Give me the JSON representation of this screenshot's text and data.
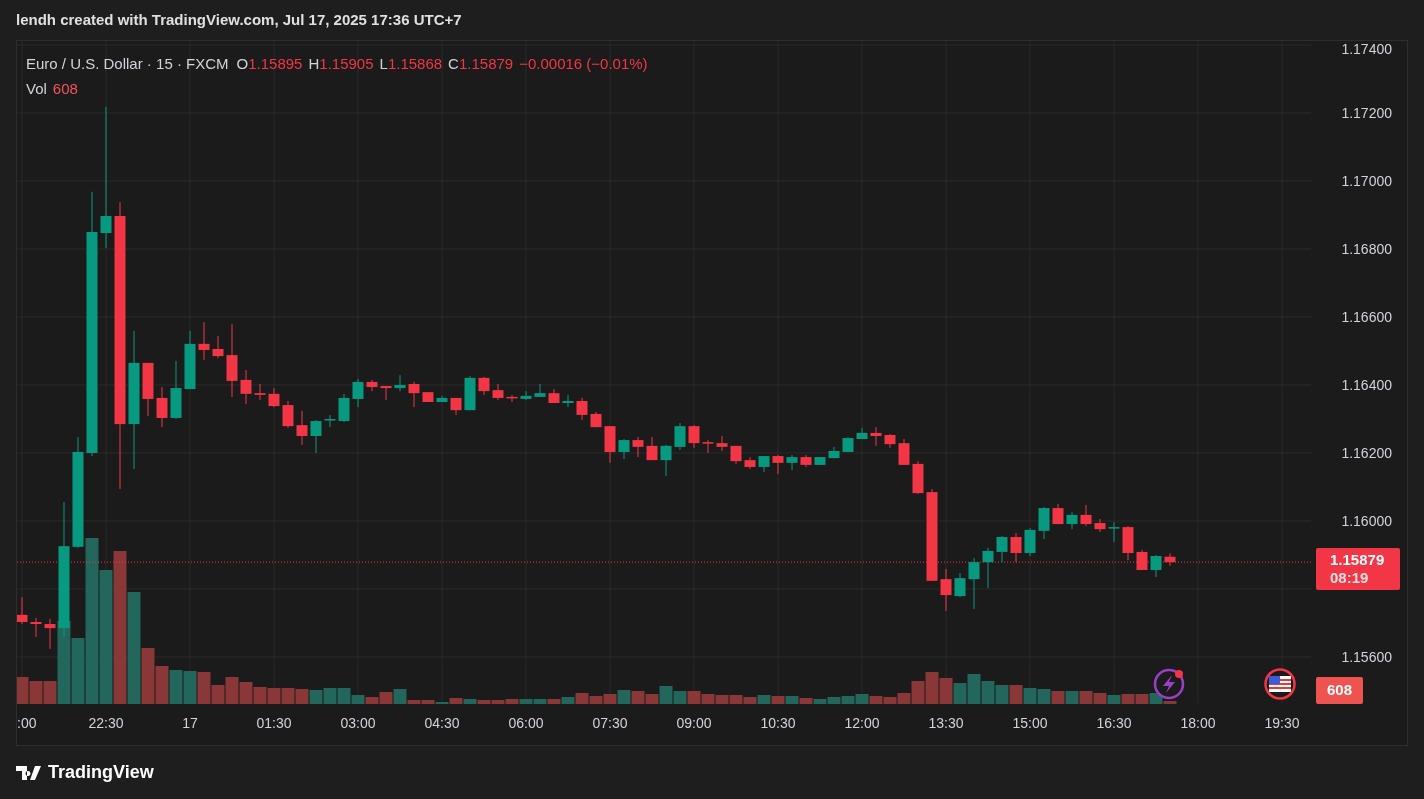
{
  "header": {
    "title": "lendh created with TradingView.com, Jul 17, 2025 17:36 UTC+7"
  },
  "legend": {
    "symbol": "Euro / U.S. Dollar · 15 · FXCM",
    "values": [
      {
        "label": "O",
        "value": "1.15895"
      },
      {
        "label": "H",
        "value": "1.15905"
      },
      {
        "label": "L",
        "value": "1.15868"
      },
      {
        "label": "C",
        "value": "1.15879"
      }
    ],
    "change": "−0.00016 (−0.01%)",
    "volume_label": "Vol",
    "volume_value": "608"
  },
  "chart": {
    "price_axis_labels": [
      "1.17400",
      "1.17200",
      "1.17000",
      "1.16800",
      "1.16600",
      "1.16400",
      "1.16200",
      "1.16000",
      "1.15600"
    ],
    "time_axis_labels": [
      ":00",
      "22:30",
      "17",
      "01:30",
      "03:00",
      "04:30",
      "06:00",
      "07:30",
      "09:00",
      "10:30",
      "12:00",
      "13:30",
      "15:00",
      "16:30",
      "18:00",
      "19:30"
    ],
    "price_tag": {
      "price": "1.15879",
      "countdown": "08:19"
    },
    "volume_tag": "608"
  },
  "footer": {
    "logo_text": "TradingView"
  }
}
